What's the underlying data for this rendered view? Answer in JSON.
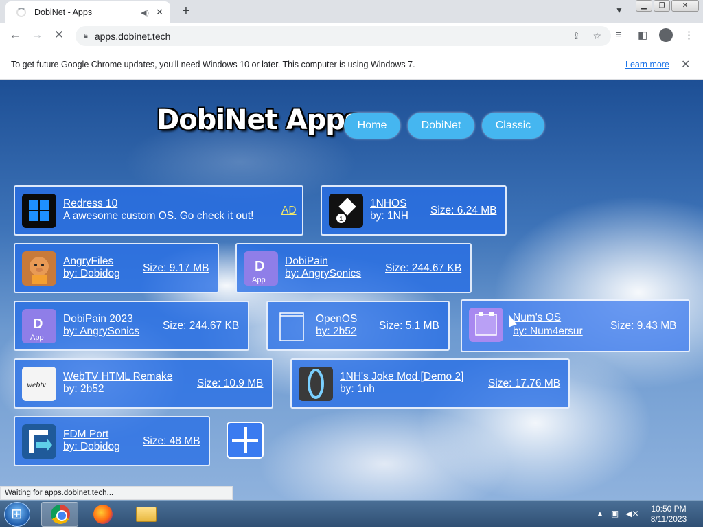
{
  "browser": {
    "tab_title": "DobiNet - Apps",
    "audio_icon": "speaker-icon",
    "tab_close": "✕",
    "new_tab": "+",
    "url": "apps.dobinet.tech",
    "infobar_message": "To get future Google Chrome updates, you'll need Windows 10 or later. This computer is using Windows 7.",
    "infobar_link": "Learn more",
    "status_text": "Waiting for apps.dobinet.tech..."
  },
  "site": {
    "logo": "DobiNet Apps",
    "nav": [
      {
        "label": "Home"
      },
      {
        "label": "DobiNet"
      },
      {
        "label": "Classic"
      }
    ]
  },
  "apps": [
    {
      "name": "Redress 10",
      "sub": "A awesome custom OS. Go check it out!",
      "tag": "AD",
      "icon": "windows-logo-icon",
      "color": "#0a0a0a"
    },
    {
      "name": "1NHOS",
      "sub": "by: 1NH",
      "size": "Size: 6.24 MB",
      "icon": "1nhos-logo-icon",
      "color": "#111111"
    },
    {
      "name": "AngryFiles",
      "sub": "by: Dobidog",
      "size": "Size: 9.17 MB",
      "icon": "angry-pig-icon",
      "color": "#c87a3a"
    },
    {
      "name": "DobiPain",
      "sub": "by: AngrySonics",
      "size": "Size: 244.67 KB",
      "icon": "dobipain-app-icon",
      "color": "#8f7ee8"
    },
    {
      "name": "DobiPain 2023",
      "sub": "by: AngrySonics",
      "size": "Size: 244.67 KB",
      "icon": "dobipain-app-icon",
      "color": "#8f7ee8"
    },
    {
      "name": "OpenOS",
      "sub": "by: 2b52",
      "size": "Size: 5.1 MB",
      "icon": "window-outline-icon",
      "color": "transparent"
    },
    {
      "name": "Num's OS",
      "sub": "by: Num4ersur",
      "size": "Size: 9.43 MB",
      "icon": "purple-box-icon",
      "color": "#a889f0"
    },
    {
      "name": "WebTV HTML Remake",
      "sub": "by: 2b52",
      "size": "Size: 10.9 MB",
      "icon": "webtv-logo-icon",
      "color": "#f4f4f4"
    },
    {
      "name": "1NH's Joke Mod [Demo 2]",
      "sub": "by: 1nh",
      "size": "Size: 17.76 MB",
      "icon": "portal-ring-icon",
      "color": "#3a3a3a"
    },
    {
      "name": "FDM Port",
      "sub": "by: Dobidog",
      "size": "Size: 48 MB",
      "icon": "fdm-logo-icon",
      "color": "#1f5a9a"
    }
  ],
  "taskbar": {
    "time": "10:50 PM",
    "date": "8/11/2023"
  }
}
